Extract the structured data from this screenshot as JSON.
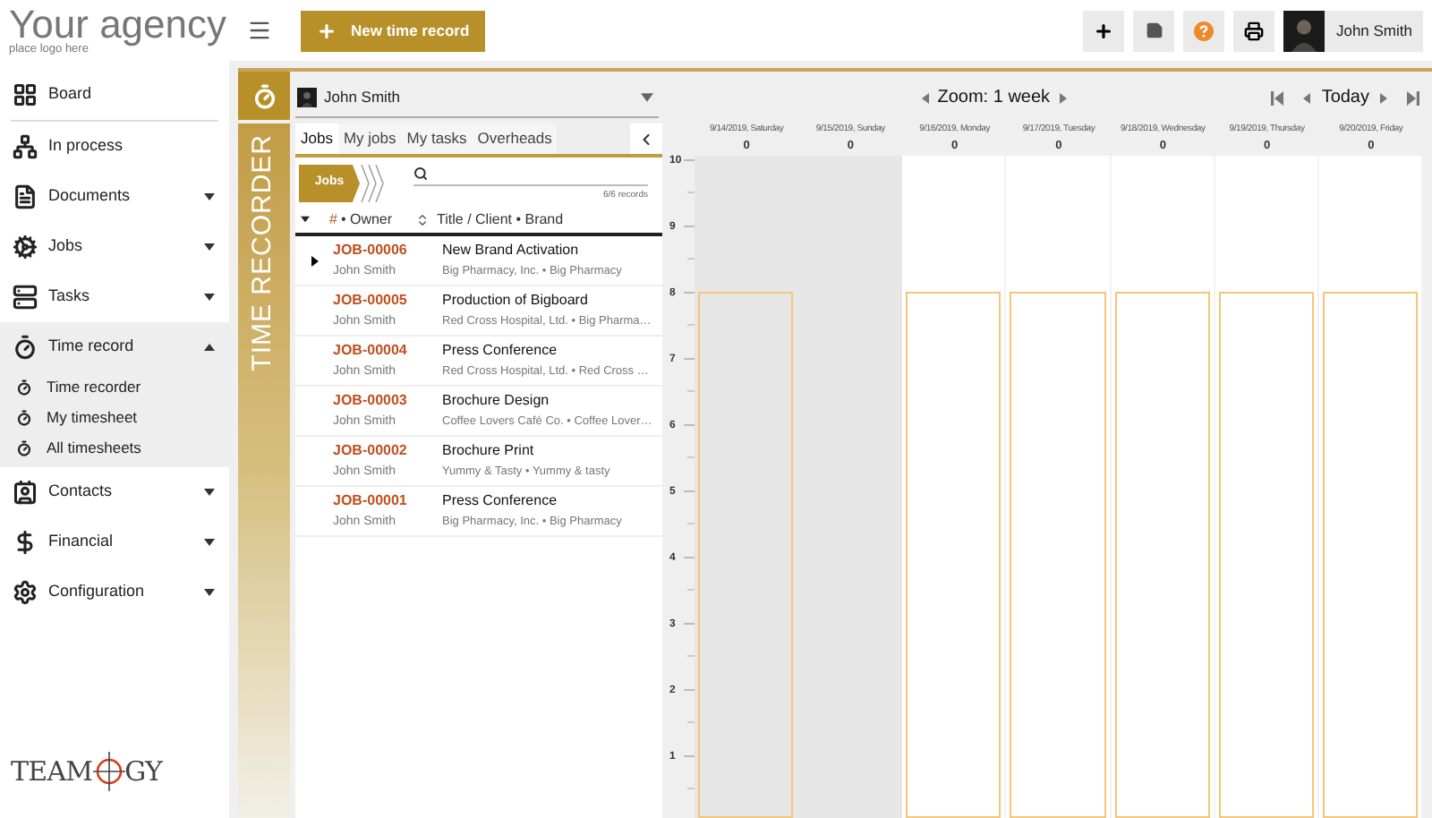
{
  "header": {
    "agency_name": "Your agency",
    "agency_hint": "place logo here",
    "new_button": "New time record",
    "user_name": "John Smith"
  },
  "sidebar": {
    "items": [
      {
        "label": "Board",
        "expandable": false,
        "expanded": false,
        "divider_after": true
      },
      {
        "label": "In process",
        "expandable": false,
        "expanded": false,
        "divider_after": false
      },
      {
        "label": "Documents",
        "expandable": true,
        "expanded": false,
        "divider_after": false
      },
      {
        "label": "Jobs",
        "expandable": true,
        "expanded": false,
        "divider_after": false
      },
      {
        "label": "Tasks",
        "expandable": true,
        "expanded": false,
        "divider_after": false
      },
      {
        "label": "Time record",
        "expandable": true,
        "expanded": true,
        "divider_after": false,
        "children": [
          {
            "label": "Time recorder"
          },
          {
            "label": "My timesheet"
          },
          {
            "label": "All timesheets"
          }
        ]
      },
      {
        "label": "Contacts",
        "expandable": true,
        "expanded": false,
        "divider_after": false
      },
      {
        "label": "Financial",
        "expandable": true,
        "expanded": false,
        "divider_after": false
      },
      {
        "label": "Configuration",
        "expandable": true,
        "expanded": false,
        "divider_after": false
      }
    ],
    "brand_logo": {
      "left": "TEAM",
      "right": "GY"
    }
  },
  "panel": {
    "module_title": "TIME RECORDER",
    "user_select": "John Smith",
    "tabs": [
      {
        "label": "Jobs",
        "selected": true
      },
      {
        "label": "My jobs",
        "selected": false
      },
      {
        "label": "My tasks",
        "selected": false
      },
      {
        "label": "Overheads",
        "selected": false
      }
    ],
    "breadcrumb": "Jobs",
    "record_count": "6/6 records",
    "columns": {
      "number": "#",
      "owner": "• Owner",
      "title": "Title / Client • Brand"
    },
    "rows": [
      {
        "number": "JOB-00006",
        "owner": "John Smith",
        "title": "New Brand Activation",
        "client": "Big Pharmacy, Inc. • Big Pharmacy",
        "selected": true
      },
      {
        "number": "JOB-00005",
        "owner": "John Smith",
        "title": "Production of Bigboard",
        "client": "Red Cross Hospital, Ltd. • Big Pharma…",
        "selected": false
      },
      {
        "number": "JOB-00004",
        "owner": "John Smith",
        "title": "Press Conference",
        "client": "Red Cross Hospital, Ltd. • Red Cross …",
        "selected": false
      },
      {
        "number": "JOB-00003",
        "owner": "John Smith",
        "title": "Brochure Design",
        "client": "Coffee Lovers Café Co. • Coffee Lover…",
        "selected": false
      },
      {
        "number": "JOB-00002",
        "owner": "John Smith",
        "title": "Brochure Print",
        "client": "Yummy & Tasty • Yummy & tasty",
        "selected": false
      },
      {
        "number": "JOB-00001",
        "owner": "John Smith",
        "title": "Press Conference",
        "client": "Big Pharmacy, Inc. • Big Pharmacy",
        "selected": false
      }
    ]
  },
  "calendar": {
    "zoom_label": "Zoom: 1 week",
    "today_label": "Today",
    "hours": [
      "10",
      "9",
      "8",
      "7",
      "6",
      "5",
      "4",
      "3",
      "2",
      "1"
    ],
    "days": [
      {
        "label": "9/14/2019, Saturday",
        "total": "0",
        "weekend": true,
        "target": true
      },
      {
        "label": "9/15/2019, Sunday",
        "total": "0",
        "weekend": true,
        "target": false
      },
      {
        "label": "9/16/2019, Monday",
        "total": "0",
        "weekend": false,
        "target": true
      },
      {
        "label": "9/17/2019, Tuesday",
        "total": "0",
        "weekend": false,
        "target": true
      },
      {
        "label": "9/18/2019, Wednesday",
        "total": "0",
        "weekend": false,
        "target": true
      },
      {
        "label": "9/19/2019, Thursday",
        "total": "0",
        "weekend": false,
        "target": true
      },
      {
        "label": "9/20/2019, Friday",
        "total": "0",
        "weekend": false,
        "target": true
      }
    ]
  }
}
